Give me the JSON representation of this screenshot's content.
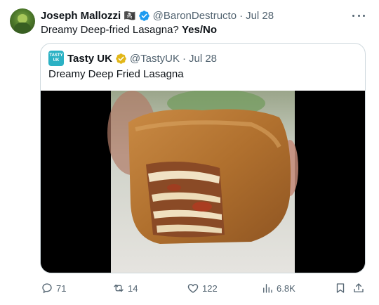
{
  "tweet": {
    "author_name": "Joseph Mallozzi",
    "author_flag": "🏴‍☠️",
    "author_handle": "@BaronDestructo",
    "separator": "·",
    "timestamp": "Jul 28",
    "text_main": "Dreamy Deep-fried Lasagna?",
    "text_bold": "Yes/No",
    "avatar_icon": "person-avatar-icon",
    "more_icon": "more-options-icon"
  },
  "quote": {
    "avatar_label": "TASTY UK",
    "author_name": "Tasty UK",
    "author_handle": "@TastyUK",
    "separator": "·",
    "timestamp": "Jul 28",
    "text": "Dreamy Deep Fried Lasagna",
    "verified_color": "#e2b719",
    "media_icon": "video-thumbnail"
  },
  "actions": {
    "replies": "71",
    "reposts": "14",
    "likes": "122",
    "views": "6.8K"
  },
  "colors": {
    "text": "#0f1419",
    "muted": "#536471",
    "verified_blue": "#1d9bf0",
    "border": "#cfd9de"
  }
}
